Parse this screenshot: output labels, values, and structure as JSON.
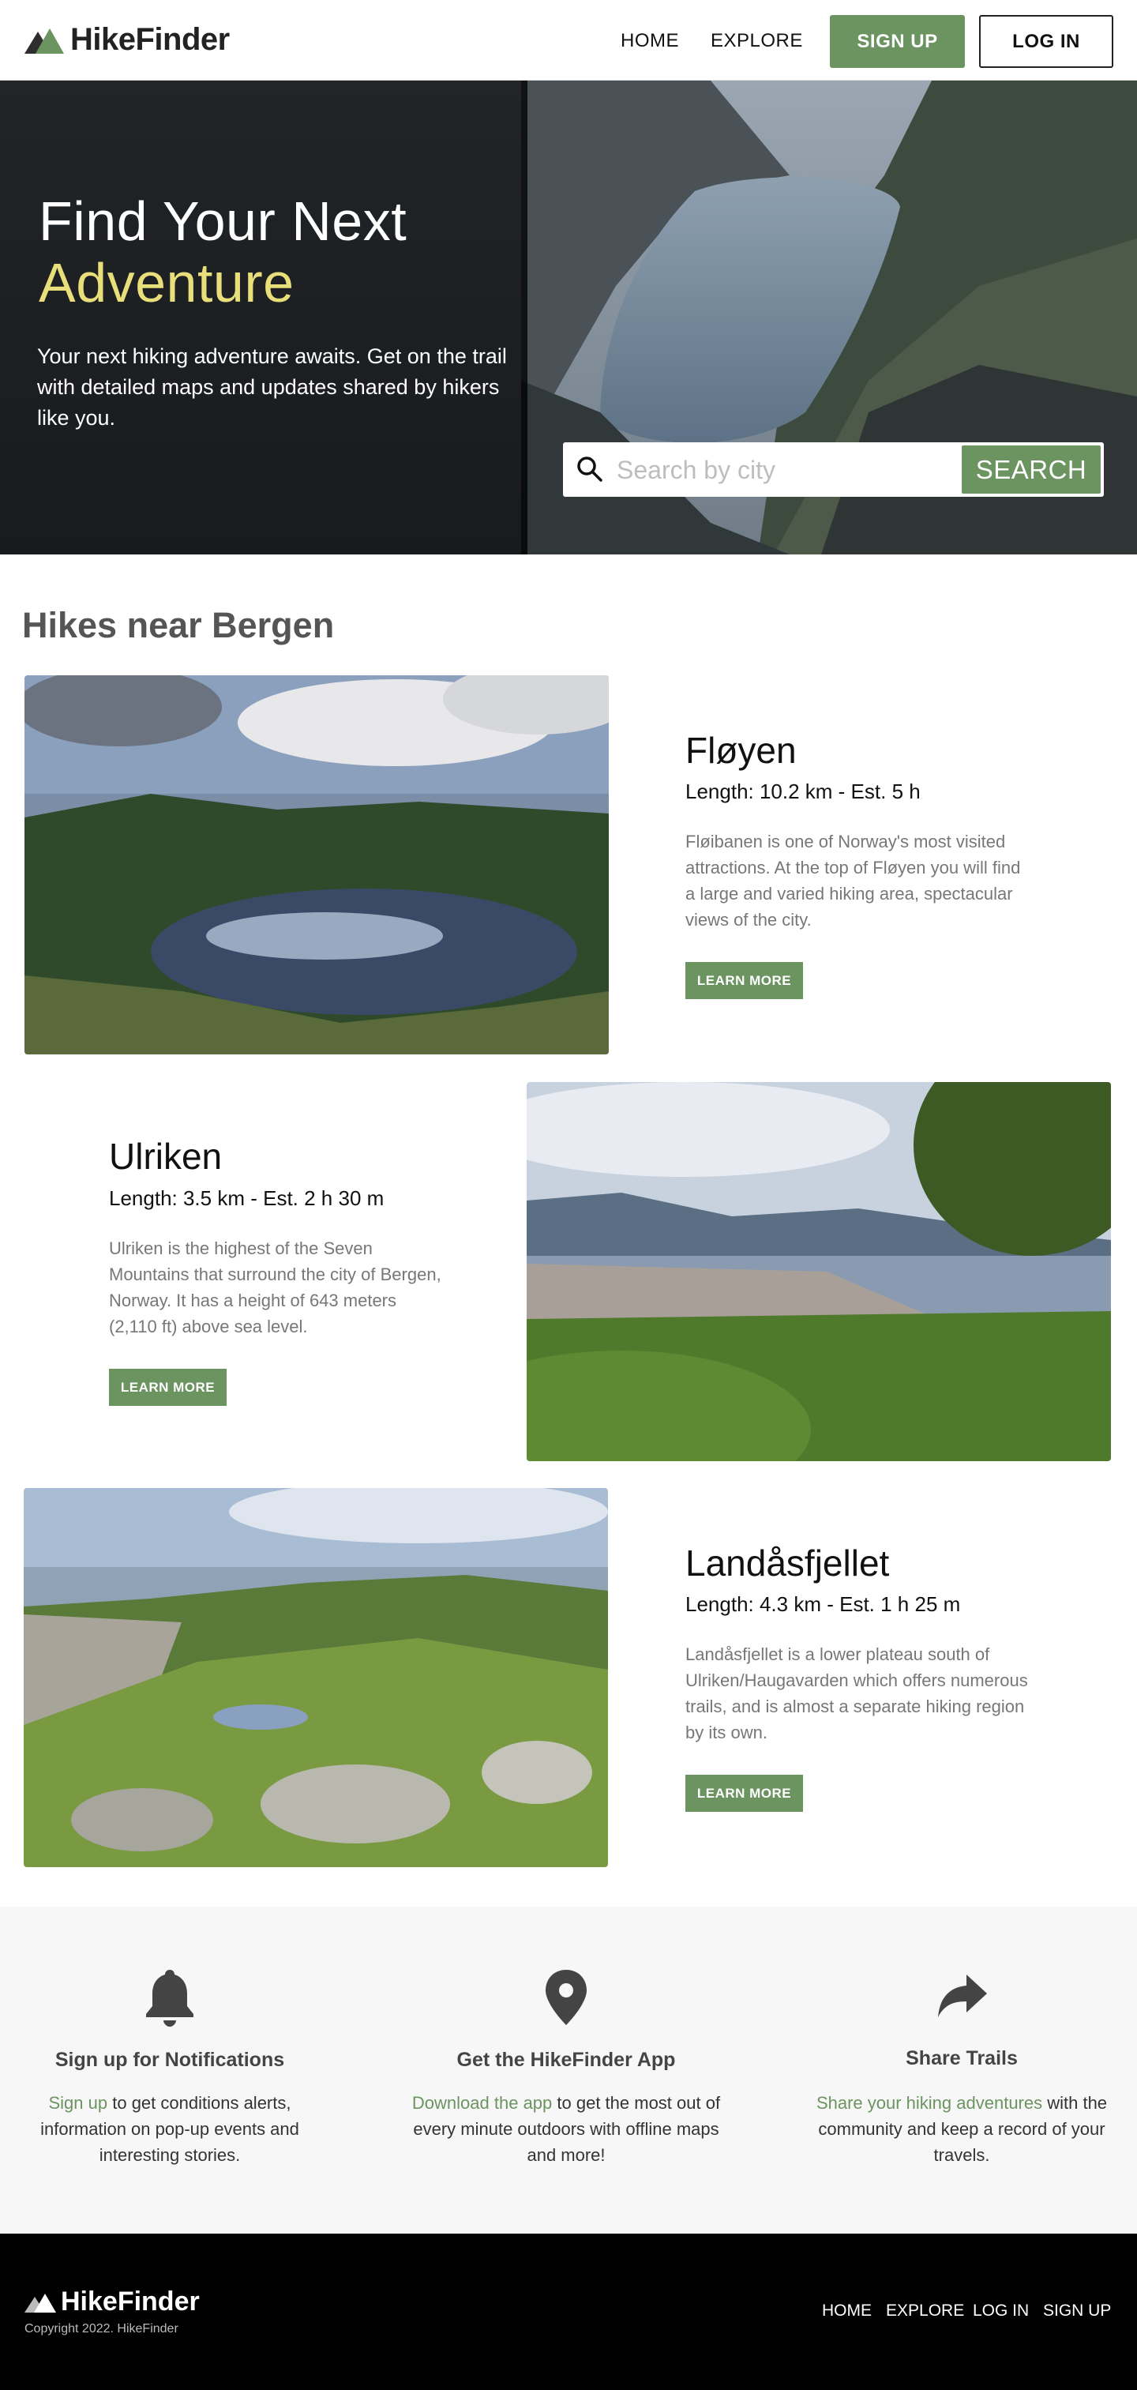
{
  "nav": {
    "brand": "HikeFinder",
    "links": [
      "HOME",
      "EXPLORE"
    ],
    "signup": "SIGN UP",
    "login": "LOG IN"
  },
  "hero": {
    "title_line1": "Find Your Next",
    "title_line2": "Adventure",
    "description": "Your next hiking adventure awaits. Get on the trail with detailed maps and updates shared by hikers like you.",
    "search_placeholder": "Search by city",
    "search_button": "SEARCH",
    "accent_color": "#e8df7a"
  },
  "hikes": {
    "section_title": "Hikes near Bergen",
    "items": [
      {
        "name": "Fløyen",
        "length": "Length: 10.2 km - Est. 5 h",
        "description": "Fløibanen is one of Norway's most visited attractions. At the top of Fløyen you will find a large and varied hiking area, spectacular views of the city.",
        "button": "LEARN MORE"
      },
      {
        "name": "Ulriken",
        "length": "Length: 3.5 km - Est. 2 h 30 m",
        "description": "Ulriken is the highest of the Seven Mountains that surround the city of Bergen, Norway. It has a height of 643 meters (2,110 ft) above sea level.",
        "button": "LEARN MORE"
      },
      {
        "name": "Landåsfjellet",
        "length": "Length: 4.3 km - Est. 1 h 25 m",
        "description": "Landåsfjellet is a lower plateau south of Ulriken/Haugavarden which offers numerous trails, and is almost a separate hiking region by its own.",
        "button": "LEARN MORE"
      }
    ]
  },
  "features": [
    {
      "icon": "bell-icon",
      "title": "Sign up for Notifications",
      "link": "Sign up",
      "text": " to get conditions alerts, information on pop-up events and interesting stories."
    },
    {
      "icon": "map-pin-icon",
      "title": "Get the HikeFinder App",
      "link": "Download the app",
      "text": " to get the most out of every minute outdoors with offline maps and more!"
    },
    {
      "icon": "share-arrow-icon",
      "title": "Share Trails",
      "link": "Share your hiking adventures",
      "text": " with the community and keep a record of your travels."
    }
  ],
  "footer": {
    "brand": "HikeFinder",
    "copyright": "Copyright 2022. HikeFinder",
    "links": [
      "HOME",
      "EXPLORE",
      "LOG IN",
      "SIGN UP"
    ]
  },
  "colors": {
    "brand_green": "#6b9461",
    "footer_bg": "#000000",
    "features_bg": "#f7f7f7"
  }
}
